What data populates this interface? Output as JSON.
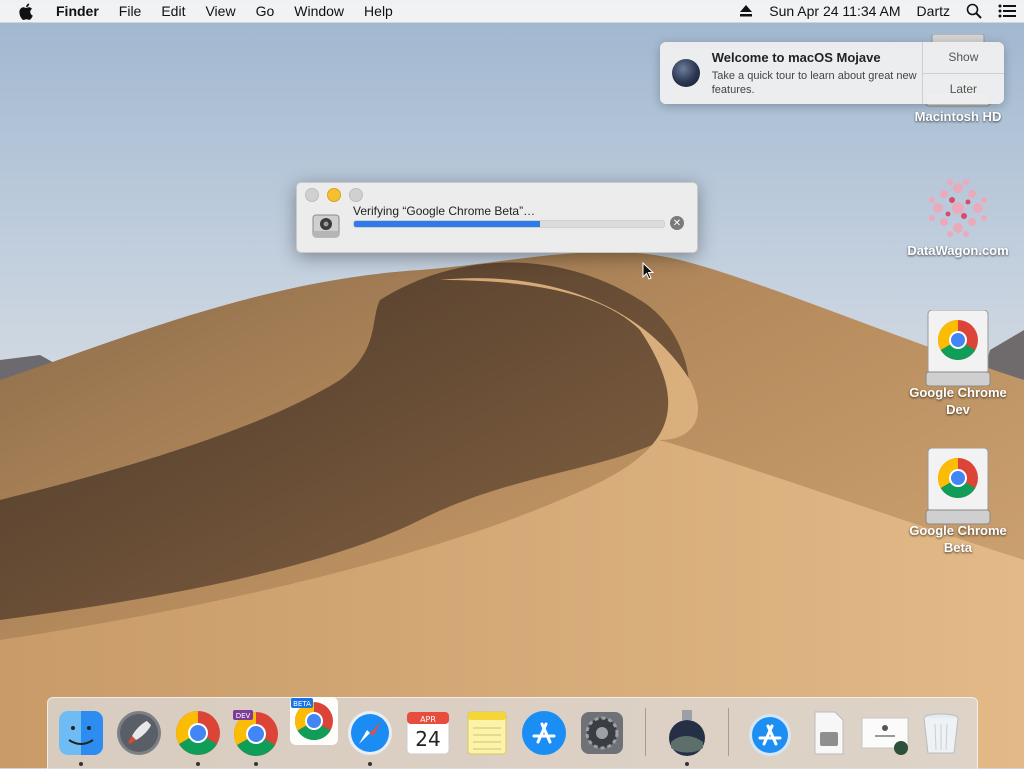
{
  "menubar": {
    "app_name": "Finder",
    "menus": [
      "File",
      "Edit",
      "View",
      "Go",
      "Window",
      "Help"
    ],
    "clock": "Sun Apr 24  11:34 AM",
    "user": "Dartz"
  },
  "notification": {
    "title": "Welcome to macOS Mojave",
    "body": "Take a quick tour to learn about great new features.",
    "show_label": "Show",
    "later_label": "Later"
  },
  "desktop_icons": [
    {
      "label": "Macintosh HD"
    },
    {
      "label": "DataWagon.com"
    },
    {
      "label_line1": "Google Chrome",
      "label_line2": "Dev"
    },
    {
      "label_line1": "Google Chrome",
      "label_line2": "Beta"
    }
  ],
  "dialog": {
    "title": "Verifying “Google Chrome Beta”…",
    "progress": 0.6
  },
  "dock": {
    "calendar_month": "APR",
    "calendar_day": "24",
    "chrome_dev_badge": "DEV",
    "chrome_beta_badge": "BETA"
  },
  "colors": {
    "accent": "#2f7be8",
    "traffic_min": "#f5bf2f"
  }
}
